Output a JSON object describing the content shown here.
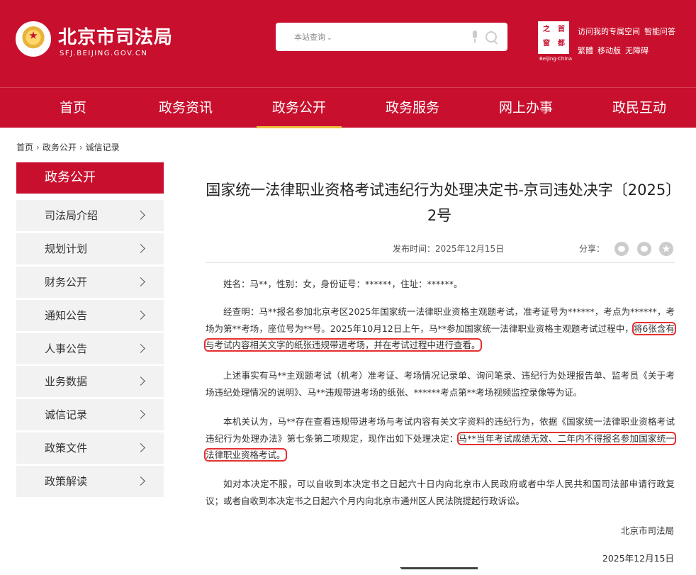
{
  "header": {
    "title": "北京市司法局",
    "domain": "SFJ.BEIJING.GOV.CN",
    "search_scope": "本站查询",
    "links_row1": [
      "访问我的专属空间",
      "智能问答"
    ],
    "links_row2": [
      "繁體",
      "移动版",
      "无障碍"
    ],
    "capital_logo": {
      "cells": [
        "之",
        "首",
        "都",
        "窗"
      ],
      "caption": "Beijing·China"
    }
  },
  "nav": [
    "首页",
    "政务资讯",
    "政务公开",
    "政务服务",
    "网上办事",
    "政民互动"
  ],
  "breadcrumb": [
    "首页",
    "政务公开",
    "诚信记录"
  ],
  "sidebar": {
    "title": "政务公开",
    "items": [
      "司法局介绍",
      "规划计划",
      "财务公开",
      "通知公告",
      "人事公告",
      "业务数据",
      "诚信记录",
      "政策文件",
      "政策解读"
    ]
  },
  "article": {
    "title": "国家统一法律职业资格考试违纪行为处理决定书-京司违处决字〔2025〕2号",
    "publish": "发布时间：2025年12月15日",
    "share": "分享：",
    "p1": "姓名：马**，性别：女，身份证号：******，住址：******。",
    "p2_a": "经查明：马**报名参加北京考区2025年国家统一法律职业资格主观题考试，准考证号为******，考点为******，考场为第**考场，座位号为**号。2025年10月12日上午，马**参加国家统一法律职业资格主观题考试过程中，",
    "p2_mark": "将6张含有与考试内容相关文字的纸张违规带进考场，并在考试过程中进行查看。",
    "p3": "上述事实有马**主观题考试（机考）准考证、考场情况记录单、询问笔录、违纪行为处理报告单、监考员《关于考场违纪处理情况的说明》、马**违规带进考场的纸张、******考点第**考场视频监控录像等为证。",
    "p4_a": "本机关认为，马**存在查看违规带进考场与考试内容有关文字资料的违纪行为，依据《国家统一法律职业资格考试违纪行为处理办法》第七条第二项规定，现作出如下处理决定：",
    "p4_mark": "马**当年考试成绩无效、二年内不得报名参加国家统一法律职业资格考试。",
    "p5": "如对本决定不服，可以自收到本决定书之日起六十日内向北京市人民政府或者中华人民共和国司法部申请行政复议；或者自收到本决定书之日起六个月内向北京市通州区人民法院提起行政诉讼。",
    "sign_org": "北京市司法局",
    "sign_date": "2025年12月15日"
  }
}
